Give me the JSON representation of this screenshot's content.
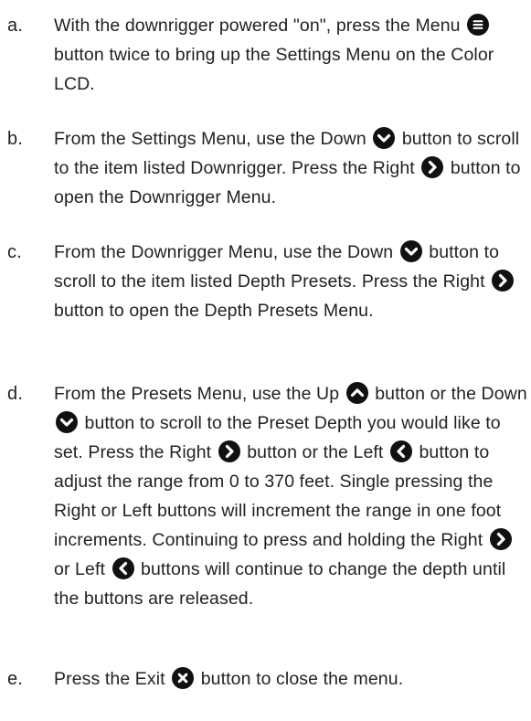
{
  "steps": [
    {
      "marker": "a.",
      "parts": [
        {
          "text": "With the downrigger powered \"on\", press the Menu "
        },
        {
          "icon": "menu-icon"
        },
        {
          "text": " button twice to bring up the Settings Menu on the Color LCD."
        }
      ]
    },
    {
      "marker": "b.",
      "parts": [
        {
          "text": "From the Settings Menu, use the Down "
        },
        {
          "icon": "chevron-down-icon"
        },
        {
          "text": " button to scroll to the item listed Downrigger. Press the Right "
        },
        {
          "icon": "chevron-right-icon"
        },
        {
          "text": " button to open the Downrigger Menu."
        }
      ]
    },
    {
      "marker": "c.",
      "parts": [
        {
          "text": "From the Downrigger Menu, use the Down "
        },
        {
          "icon": "chevron-down-icon"
        },
        {
          "text": " button to scroll to the item listed Depth Presets. Press the Right "
        },
        {
          "icon": "chevron-right-icon"
        },
        {
          "text": " button to open the Depth Presets Menu."
        }
      ]
    },
    {
      "marker": "d.",
      "parts": [
        {
          "text": "From the Presets Menu, use the Up "
        },
        {
          "icon": "chevron-up-icon"
        },
        {
          "text": " button or the Down "
        },
        {
          "icon": "chevron-down-icon"
        },
        {
          "text": " button to scroll to the Preset Depth you would like to set. Press the Right "
        },
        {
          "icon": "chevron-right-icon"
        },
        {
          "text": " button or the Left "
        },
        {
          "icon": "chevron-left-icon"
        },
        {
          "text": " button to adjust the range from 0 to 370 feet. Single pressing the Right or Left buttons will increment the range in one foot increments. Continuing to press and holding the Right "
        },
        {
          "icon": "chevron-right-icon"
        },
        {
          "text": " or Left "
        },
        {
          "icon": "chevron-left-icon"
        },
        {
          "text": " buttons will continue to change the depth until the buttons are released."
        }
      ]
    },
    {
      "marker": "e.",
      "parts": [
        {
          "text": "Press the Exit "
        },
        {
          "icon": "close-icon"
        },
        {
          "text": " button to close the menu."
        }
      ]
    }
  ],
  "style": {
    "text_color": "#222222",
    "icon_fill": "#111111",
    "icon_glyph": "#ffffff"
  }
}
